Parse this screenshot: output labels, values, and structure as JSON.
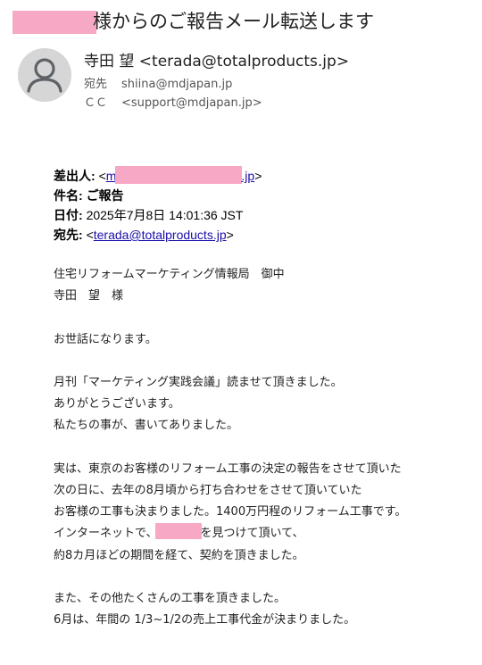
{
  "email": {
    "subject_suffix": "様からのご報告メール転送します",
    "sender": "寺田 望 <terada@totalproducts.jp>",
    "to_label": "宛先",
    "to_value": "shiina@mdjapan.jp",
    "cc_label": "ＣＣ",
    "cc_value": "<support@mdjapan.jp>"
  },
  "forwarded": {
    "from_label": "差出人:",
    "from_open": "<",
    "from_prefix": "m",
    "from_suffix": ".jp",
    "from_close": ">",
    "subject_label": "件名:",
    "subject_value": "ご報告",
    "date_label": "日付:",
    "date_value": "2025年7月8日 14:01:36 JST",
    "to_label": "宛先:",
    "to_open": "<",
    "to_value": "terada@totalproducts.jp",
    "to_close": ">"
  },
  "body": {
    "line1": "住宅リフォームマーケティング情報局　御中",
    "line2": "寺田　望　様",
    "line3": "お世話になります。",
    "line4": "月刊「マーケティング実践会議」読ませて頂きました。",
    "line5": "ありがとうございます。",
    "line6": "私たちの事が、書いてありました。",
    "line7": "実は、東京のお客様のリフォーム工事の決定の報告をさせて頂いた",
    "line8": "次の日に、去年の8月頃から打ち合わせをさせて頂いていた",
    "line9": "お客様の工事も決まりました。1400万円程のリフォーム工事です。",
    "line10_pre": "インターネットで、",
    "line10_post": "を見つけて頂いて、",
    "line11": "約8カ月ほどの期間を経て、契約を頂きました。",
    "line12": "また、その他たくさんの工事を頂きました。",
    "line13": "6月は、年間の 1/3~1/2の売上工事代金が決まりました。"
  },
  "colors": {
    "redaction": "#f7a8c4",
    "link": "#1a0dab",
    "avatar_bg": "#d6d6d6"
  },
  "icons": {
    "avatar": "person-icon"
  }
}
